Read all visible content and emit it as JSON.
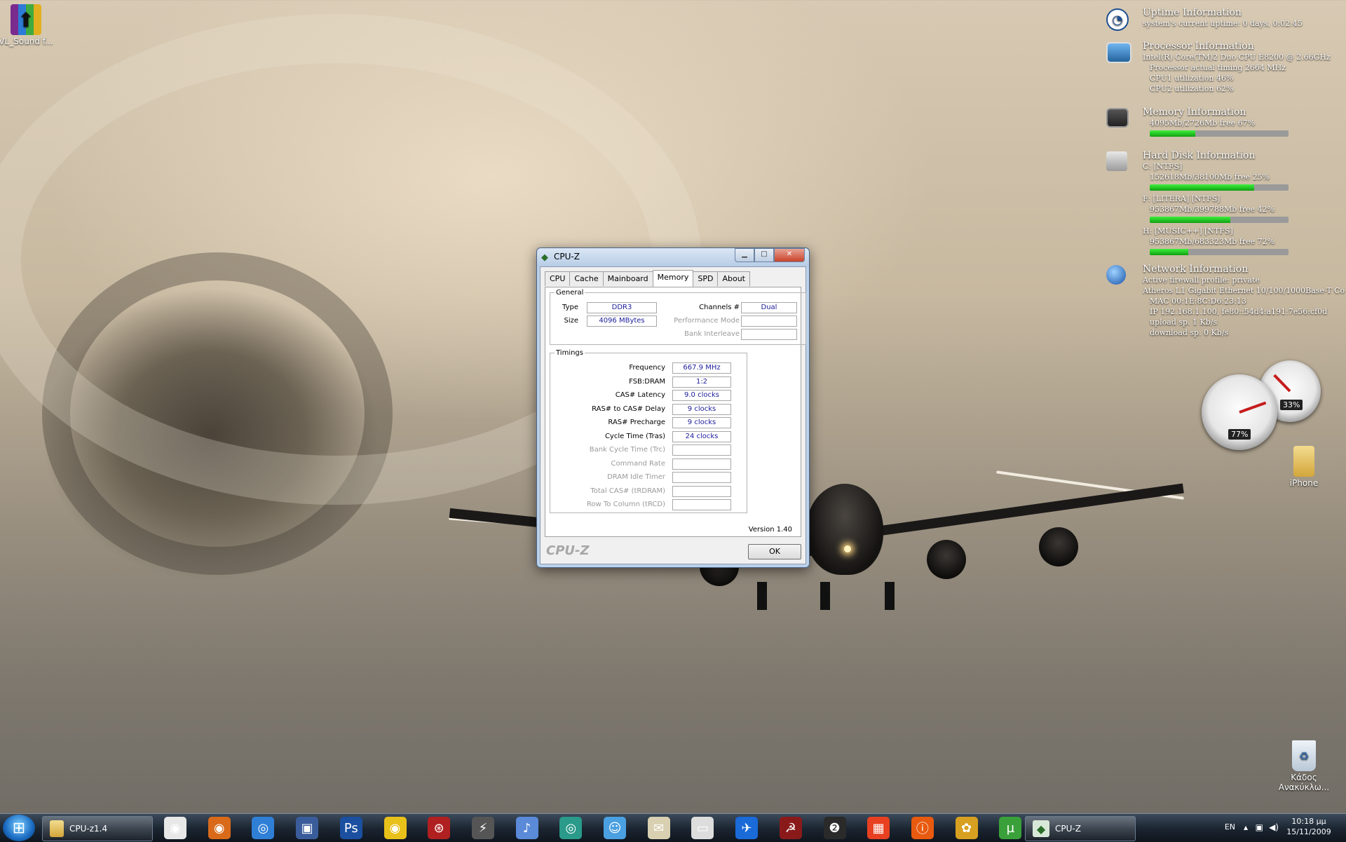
{
  "desktop": {
    "icons": [
      {
        "label": "VL_Sound f...",
        "icon": "winrar-archive-icon"
      },
      {
        "label": "iPhone",
        "icon": "folder-icon"
      },
      {
        "label": "Κάδος Ανακύκλω...",
        "icon": "recycle-bin-icon"
      }
    ]
  },
  "gadgets": {
    "uptime": {
      "title": "Uptime Information",
      "line": "system's current uptime: 0 days, 0:02:45"
    },
    "processor": {
      "title": "Processor Information",
      "cpu_name": "Intel(R) Core(TM)2 Duo CPU     E8200  @ 2.66GHz",
      "timing": "Processor actual timing 2664 MHz",
      "cpu1": "CPU1 utilization      46%",
      "cpu2": "CPU2 utilization      62%"
    },
    "memory": {
      "title": "Memory Information",
      "line": "4095Mb/2726Mb  free 67%",
      "used_fraction": 0.33
    },
    "disk": {
      "title": "Hard Disk Information",
      "drives": [
        {
          "name": "C: [NTFS]",
          "line": "152618Mb/38100Mb  free 25%",
          "used_fraction": 0.75
        },
        {
          "name": "F: [LITERA]  [NTFS]",
          "line": "953867Mb/399788Mb  free 42%",
          "used_fraction": 0.58
        },
        {
          "name": "H: [MUSIC++]  [NTFS]",
          "line": "953867Mb/683323Mb  free 72%",
          "used_fraction": 0.28
        }
      ]
    },
    "network": {
      "title": "Network Information",
      "firewall": "Active firewall profile: private",
      "adapter": "Atheros L1 Gigabit Ethernet 10/100/1000Base-T Co",
      "mac": "MAC 00:1E:8C:D6:23:13",
      "ip": "IP  192.168.1.100, fe80::54d4:a191:7e56:cf0d",
      "upload": "upload sp.       1 Kb/s",
      "download": "download sp.  0 Kb/s"
    },
    "gauges": {
      "cpu_label": "77%",
      "mem_label": "33%",
      "cpu_value": 0.77,
      "mem_value": 0.33
    }
  },
  "cpuz": {
    "title": "CPU-Z",
    "tabs": [
      "CPU",
      "Cache",
      "Mainboard",
      "Memory",
      "SPD",
      "About"
    ],
    "active_tab": "Memory",
    "general": {
      "legend": "General",
      "type_label": "Type",
      "type_value": "DDR3",
      "size_label": "Size",
      "size_value": "4096 MBytes",
      "channels_label": "Channels #",
      "channels_value": "Dual",
      "perf_mode_label": "Performance Mode",
      "bank_interleave_label": "Bank Interleave"
    },
    "timings": {
      "legend": "Timings",
      "rows": [
        {
          "label": "Frequency",
          "value": "667.9 MHz",
          "enabled": true
        },
        {
          "label": "FSB:DRAM",
          "value": "1:2",
          "enabled": true
        },
        {
          "label": "CAS# Latency",
          "value": "9.0 clocks",
          "enabled": true
        },
        {
          "label": "RAS# to CAS# Delay",
          "value": "9 clocks",
          "enabled": true
        },
        {
          "label": "RAS# Precharge",
          "value": "9 clocks",
          "enabled": true
        },
        {
          "label": "Cycle Time (Tras)",
          "value": "24 clocks",
          "enabled": true
        },
        {
          "label": "Bank Cycle Time (Trc)",
          "value": "",
          "enabled": false
        },
        {
          "label": "Command Rate",
          "value": "",
          "enabled": false
        },
        {
          "label": "DRAM Idle Timer",
          "value": "",
          "enabled": false
        },
        {
          "label": "Total CAS# (tRDRAM)",
          "value": "",
          "enabled": false
        },
        {
          "label": "Row To Column (tRCD)",
          "value": "",
          "enabled": false
        }
      ]
    },
    "version": "Version 1.40",
    "brand": "CPU-Z",
    "ok_label": "OK"
  },
  "taskbar": {
    "start_icon": "windows-orb-icon",
    "buttons": [
      {
        "label": "CPU-z1.4",
        "icon": "folder-icon"
      },
      {
        "label": "CPU-Z",
        "icon": "cpuz-icon"
      }
    ],
    "quick_launch": [
      "chrome-icon",
      "firefox-icon",
      "safari-icon",
      "remote-desktop-icon",
      "photoshop-icon",
      "disc-burner-icon",
      "media-app-icon",
      "winamp-icon",
      "itunes-icon",
      "globe-app-icon",
      "messenger-icon",
      "mail-icon",
      "slingbox-icon",
      "plane-app-icon",
      "rss-icon",
      "steam-icon",
      "ms-office-icon",
      "info-icon",
      "gear-app-icon",
      "utorrent-icon"
    ],
    "tray": {
      "lang": "EN",
      "time": "10:18 μμ",
      "date": "15/11/2009"
    }
  }
}
